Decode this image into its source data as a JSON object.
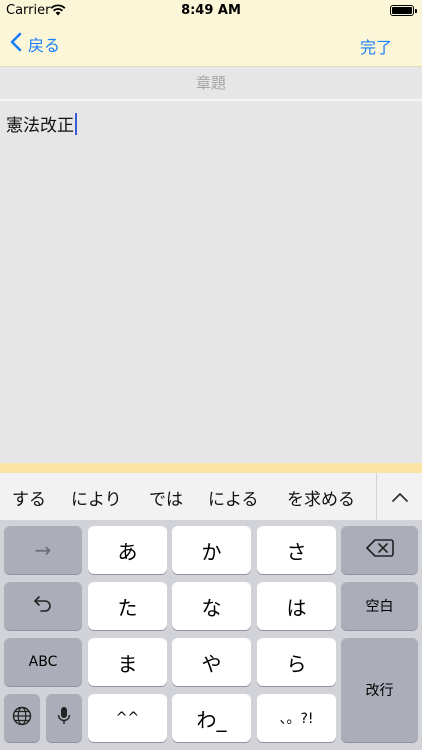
{
  "status_bar": {
    "carrier": "Carrier",
    "time": "8:49 AM"
  },
  "nav": {
    "back_label": "戻る",
    "done_label": "完了"
  },
  "chapter": {
    "placeholder": "章題"
  },
  "editor": {
    "text": "憲法改正"
  },
  "suggestions": [
    "する",
    "により",
    "では",
    "による",
    "を求める"
  ],
  "keyboard": {
    "arrow": "→",
    "row1": [
      "あ",
      "か",
      "さ"
    ],
    "row2": [
      "た",
      "な",
      "は"
    ],
    "row3": [
      "ま",
      "や",
      "ら"
    ],
    "row4": [
      "^^",
      "わ_",
      "、。?!"
    ],
    "space_label": "空白",
    "abc_label": "ABC",
    "return_label": "改行"
  },
  "colors": {
    "accent": "#1a7ef5",
    "header_bg": "#fbf6d8",
    "editor_bg": "#e6e6e6",
    "keyboard_bg": "#d1d3d9"
  }
}
